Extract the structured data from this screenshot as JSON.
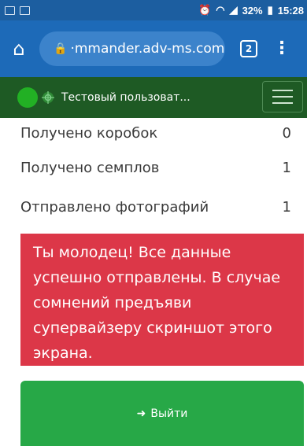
{
  "status_bar": {
    "battery": "32%",
    "time": "15:28"
  },
  "browser": {
    "url": "·mmander.adv-ms.com",
    "tab_count": "2"
  },
  "navbar": {
    "user_name": "Тестовый пользоват..."
  },
  "stats": [
    {
      "label": "Получено коробок",
      "value": "0"
    },
    {
      "label": "Получено семплов",
      "value": "1"
    },
    {
      "label": "Отправлено фотографий",
      "value": "1"
    }
  ],
  "alert": {
    "text": "Ты молодец! Все данные успешно отправлены. В случае сомнений предъяви супервайзеру скриншот этого экрана."
  },
  "logout": {
    "label": "Выйти"
  },
  "colors": {
    "status_bar": "#1c5ea0",
    "browser_bar": "#1d6ab8",
    "navbar": "#1e5a24",
    "alert": "#dc3748",
    "logout": "#27a847"
  },
  "icons": [
    "image-icon",
    "checkbox-icon",
    "alarm-icon",
    "wifi-icon",
    "signal-icon",
    "battery-icon",
    "home-icon",
    "lock-icon",
    "tabs-icon",
    "menu-icon",
    "crosshair-icon",
    "sign-out-icon"
  ]
}
